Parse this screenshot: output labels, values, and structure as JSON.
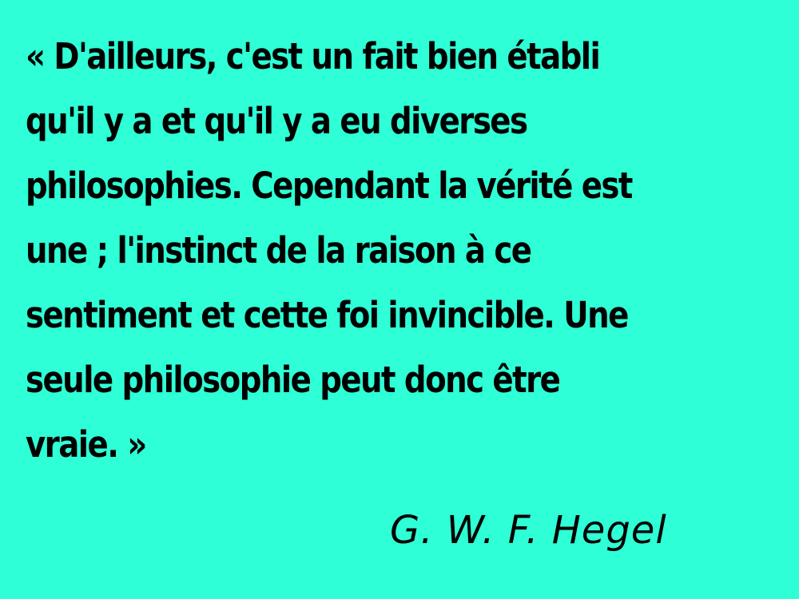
{
  "slide": {
    "background_color": "#2effd6",
    "text_color": "#000000"
  },
  "quote": {
    "lines": [
      "« D'ailleurs, c'est un fait bien établi",
      "qu'il y a et qu'il y a eu diverses",
      "philosophies. Cependant la vérité est",
      "une ; l'instinct de la raison à ce",
      "sentiment et cette foi invincible. Une",
      "seule philosophie peut donc être",
      "vraie. »"
    ]
  },
  "attribution": {
    "author": "G. W. F. Hegel"
  }
}
